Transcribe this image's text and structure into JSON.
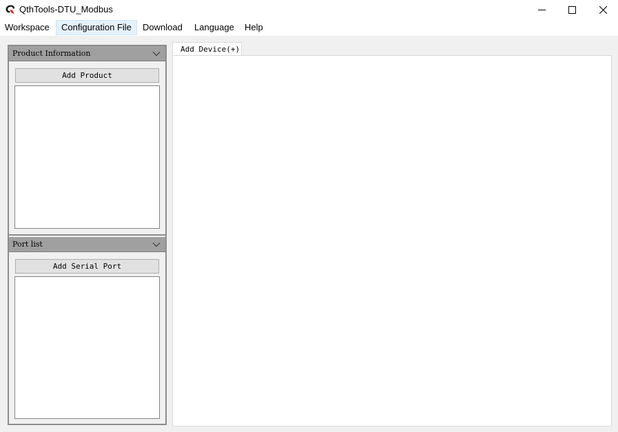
{
  "window": {
    "title": "QthTools-DTU_Modbus",
    "app_icon": "qthtools-logo-icon",
    "controls": [
      "minimize-icon",
      "maximize-icon",
      "close-icon"
    ]
  },
  "menu": {
    "items": [
      {
        "label": "Workspace"
      },
      {
        "label": "Configuration File",
        "active": true
      },
      {
        "label": "Download"
      },
      {
        "label": "Language"
      },
      {
        "label": "Help"
      }
    ]
  },
  "left_panel": {
    "product_info": {
      "title": "Product Information",
      "button_label": "Add Product",
      "items": []
    },
    "port_list": {
      "title": "Port list",
      "button_label": "Add Serial Port",
      "items": []
    }
  },
  "main": {
    "tabs": [
      {
        "label": "Add Device(+)",
        "active": true
      }
    ]
  },
  "colors": {
    "window_bg": "#f0f0f0",
    "group_header_bg": "#a0a0a0",
    "menu_highlight": "#e5f1fb",
    "logo_red": "#d9261c"
  }
}
